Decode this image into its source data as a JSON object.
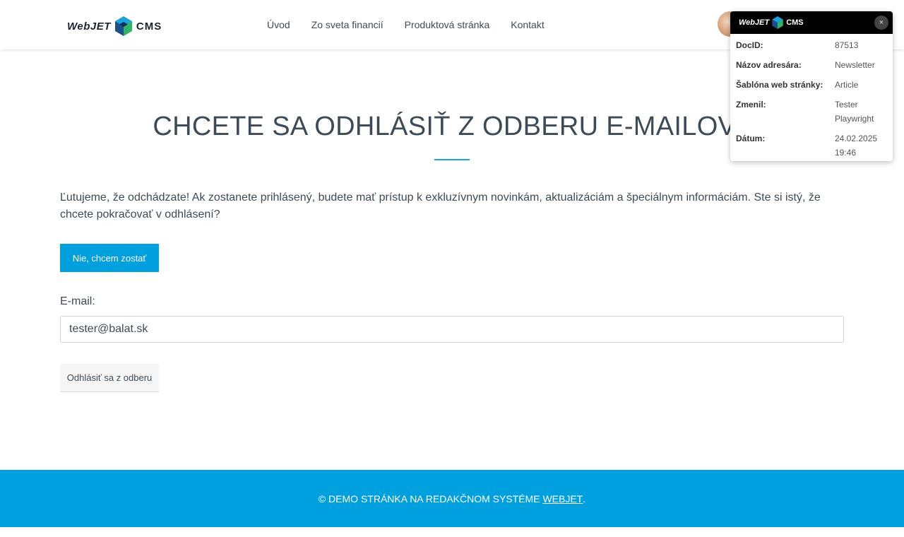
{
  "header": {
    "logo_text_1": "WebJET",
    "logo_text_2": "CMS",
    "nav": [
      "Úvod",
      "Zo sveta financií",
      "Produktová stránka",
      "Kontakt"
    ]
  },
  "main": {
    "title": "CHCETE SA ODHLÁSIŤ Z ODBERU E-MAILOV?",
    "intro": "Ľutujeme, že odchádzate! Ak zostanete prihlásený, budete mať prístup k exkluzívnym novinkám, aktualizáciám a špeciálnym informáciám. Ste si istý, že chcete pokračovať v odhlásení?",
    "stay_label": "Nie, chcem zostať",
    "email_label": "E-mail:",
    "email_value": "tester@balat.sk",
    "unsubscribe_label": "Odhlásiť sa z odberu"
  },
  "footer": {
    "text": "© DEMO STRÁNKA NA REDAKČNOM SYSTÉME ",
    "link": "WEBJET",
    "suffix": "."
  },
  "info_panel": {
    "close": "×",
    "rows": [
      {
        "key": "DocID:",
        "value": "87513"
      },
      {
        "key": "Názov adresára:",
        "value": "Newsletter"
      },
      {
        "key": "Šablóna web stránky:",
        "value": "Article"
      },
      {
        "key": "Zmenil:",
        "value": "Tester Playwright"
      },
      {
        "key": "Dátum:",
        "value": "24.02.2025 19:46"
      }
    ]
  },
  "colors": {
    "accent": "#009fde",
    "text": "#3d4b57"
  },
  "icons": {
    "logo": "webjet-cube-icon",
    "close": "close-icon"
  }
}
